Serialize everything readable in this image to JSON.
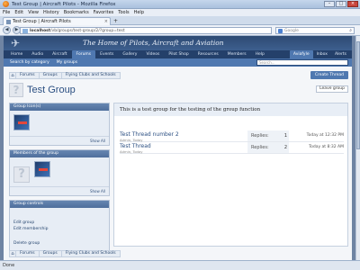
{
  "window": {
    "title": "Test Group | Aircraft Pilots - Mozilla Firefox"
  },
  "menu": [
    "File",
    "Edit",
    "View",
    "History",
    "Bookmarks",
    "Favorites",
    "Tools",
    "Help"
  ],
  "tab": {
    "title": "Test Group | Aircraft Pilots"
  },
  "address": {
    "host": "localhost",
    "path": "/vb/groups/test-group/2/?group=test"
  },
  "search_bar": {
    "placeholder": "Google"
  },
  "site": {
    "banner": "The Home of Pilots, Aircraft and Aviation",
    "nav": [
      "Home",
      "Audio",
      "Aircraft",
      "Forums",
      "Events",
      "Gallery",
      "Videos",
      "Pilot Shop",
      "Resources",
      "Members",
      "Help"
    ],
    "nav_right": [
      "Aviafyle",
      "Inbox",
      "Alerts"
    ],
    "subnav": [
      "Search by category",
      "My groups"
    ],
    "search_placeholder": "Search..."
  },
  "breadcrumbs": [
    "Forums",
    "Groups",
    "Flying Clubs and Schools"
  ],
  "buttons": {
    "create_thread": "Create Thread",
    "leave_group": "Leave group"
  },
  "group": {
    "title": "Test Group",
    "description": "This is a test group for the testing of the group function"
  },
  "sidebar": {
    "group_icon_title": "Group Icon(s)",
    "members_title": "Members of the group",
    "controls_title": "Group controls",
    "show_all": "Show All",
    "links": [
      "Edit group",
      "Edit membership",
      "Delete group"
    ]
  },
  "threads": [
    {
      "title": "Test Thread number 2",
      "author": "Admin, Today",
      "replies_label": "Replies:",
      "replies": "1",
      "when": "Today at 12:32 PM"
    },
    {
      "title": "Test Thread",
      "author": "Admin, Today",
      "replies_label": "Replies:",
      "replies": "2",
      "when": "Today at 8:32 AM"
    }
  ],
  "status": "Done"
}
